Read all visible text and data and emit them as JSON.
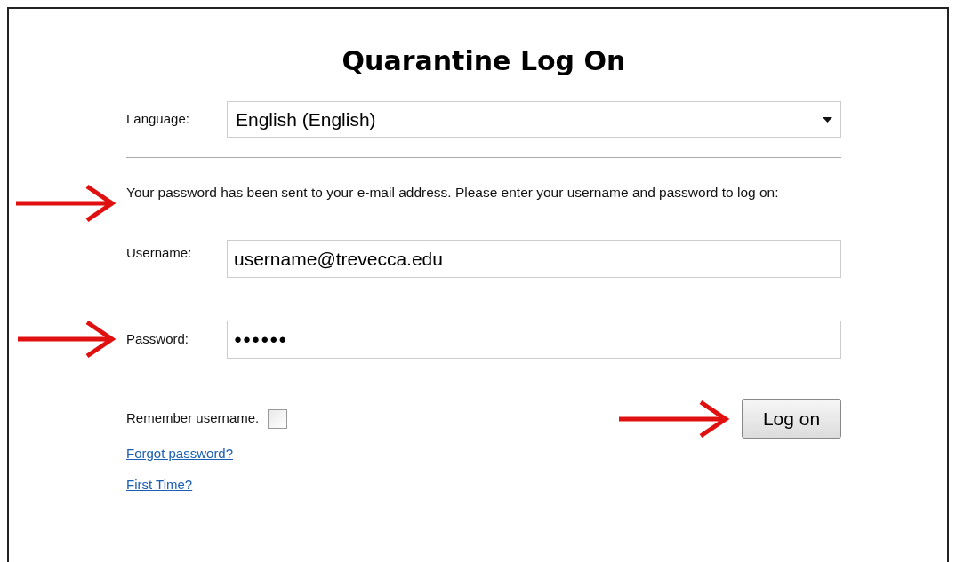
{
  "title": "Quarantine Log On",
  "language": {
    "label": "Language:",
    "value": "English (English)"
  },
  "message": "Your password has been sent to your e-mail address. Please enter your username and password to log on:",
  "username": {
    "label": "Username:",
    "value": "username@trevecca.edu"
  },
  "password": {
    "label": "Password:",
    "value": "●●●●●●"
  },
  "remember": {
    "label": "Remember username.",
    "checked": false
  },
  "submit": "Log on",
  "links": [
    "Forgot password?",
    "First Time?"
  ]
}
